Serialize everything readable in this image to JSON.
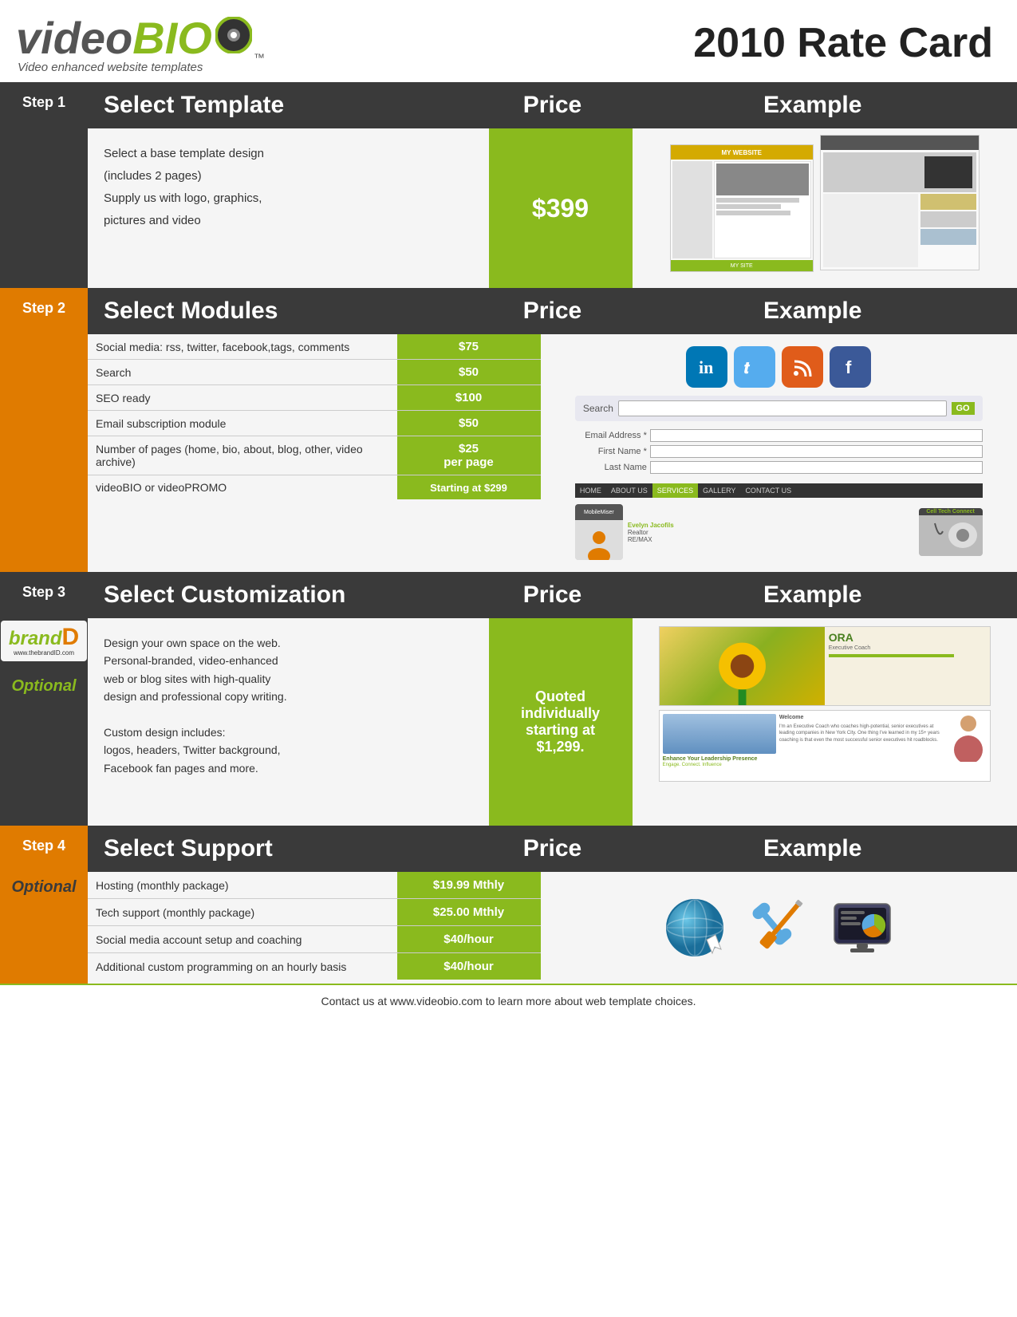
{
  "header": {
    "logo_video": "video",
    "logo_bio": "BIO",
    "logo_tm": "™",
    "logo_tagline": "Video enhanced website templates",
    "rate_card_title": "2010 Rate Card"
  },
  "step1": {
    "step_label": "Step 1",
    "col_title": "Select Template",
    "col_price": "Price",
    "col_example": "Example",
    "desc_line1": "Select a base template design",
    "desc_line2": "(includes 2 pages)",
    "desc_line3": "Supply us with logo, graphics,",
    "desc_line4": "pictures and video",
    "price": "$399"
  },
  "step2": {
    "step_label": "Step 2",
    "col_title": "Select Modules",
    "col_price": "Price",
    "col_example": "Example",
    "rows": [
      {
        "desc": "Social media: rss, twitter, facebook, tags, comments",
        "price": "$75"
      },
      {
        "desc": "Search",
        "price": "$50"
      },
      {
        "desc": "SEO ready",
        "price": "$100"
      },
      {
        "desc": "Email subscription module",
        "price": "$50"
      },
      {
        "desc": "Number of pages (home, bio, about, blog, other, video archive)",
        "price": "$25\nper page"
      },
      {
        "desc": "videoBIO or videoPROMO",
        "price": "Starting at $299"
      }
    ]
  },
  "step3": {
    "step_label": "Step 3",
    "col_title": "Select Customization",
    "col_price": "Price",
    "col_example": "Example",
    "optional_label": "Optional",
    "brand_sub": "www.thebrandID.com",
    "desc_para1_line1": "Design your own space on the web.",
    "desc_para1_line2": "Personal-branded, video-enhanced",
    "desc_para1_line3": "web or blog sites with high-quality",
    "desc_para1_line4": "design and professional copy writing.",
    "desc_para2_line1": "Custom design includes:",
    "desc_para2_line2": "logos, headers, Twitter background,",
    "desc_para2_line3": "Facebook fan pages and more.",
    "price_line1": "Quoted",
    "price_line2": "individually",
    "price_line3": "starting at",
    "price_line4": "$1,299."
  },
  "step4": {
    "step_label": "Step 4",
    "col_title": "Select Support",
    "col_price": "Price",
    "col_example": "Example",
    "optional_label": "Optional",
    "rows": [
      {
        "desc": "Hosting (monthly package)",
        "price": "$19.99 Mthly"
      },
      {
        "desc": "Tech support (monthly package)",
        "price": "$25.00 Mthly"
      },
      {
        "desc": "Social media account setup and coaching",
        "price": "$40/hour"
      },
      {
        "desc": "Additional custom programming on an hourly basis",
        "price": "$40/hour"
      }
    ]
  },
  "footer": {
    "text": "Contact us at www.videobio.com to learn more about web template choices."
  },
  "ui": {
    "search_placeholder": "Search",
    "go_button": "GO",
    "email_label": "Email Address *",
    "first_name_label": "First Name *",
    "last_name_label": "Last Name",
    "nav_home": "HOME",
    "nav_about": "ABOUT US",
    "nav_services": "SERVICES",
    "nav_gallery": "GALLERY",
    "nav_contact": "CONTACT US"
  }
}
